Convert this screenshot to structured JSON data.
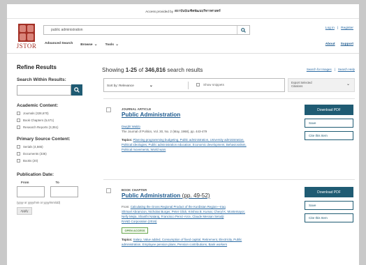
{
  "topbar": {
    "access_prefix": "Access provided by",
    "institution": "สถาบันบัณฑิตพัฒนบริหารศาสตร์"
  },
  "logo": {
    "text": "JSTOR"
  },
  "search": {
    "query": "public administration"
  },
  "nav": {
    "advanced": "Advanced Search",
    "browse": "Browse",
    "tools": "Tools"
  },
  "account": {
    "login": "Log in",
    "sep": "|",
    "register": "Register"
  },
  "links": {
    "about": "About",
    "support": "Support"
  },
  "sidebar": {
    "title": "Refine Results",
    "search_within": "Search Within Results:",
    "academic_heading": "Academic Content:",
    "academic": [
      "Journals (328,670)",
      "Book Chapters (5,671)",
      "Research Reports (3,351)"
    ],
    "primary_heading": "Primary Source Content:",
    "primary": [
      "Serials (4,566)",
      "Documents (336)",
      "Books (20)"
    ],
    "date_heading": "Publication Date:",
    "from_label": "From",
    "to_label": "To",
    "date_hint": "(yyyy or yyyy/mm or yyyy/mm/dd)",
    "apply": "Apply"
  },
  "results": {
    "showing": "Showing",
    "range": "1-25",
    "of": "of",
    "total": "346,816",
    "suffix": "search results",
    "search_images": "Search for Images",
    "sep": "|",
    "search_help": "Search Help",
    "sort_label": "Sort by: Relevance",
    "show_snippets": "Show snippets",
    "export_line1": "Export Selected",
    "export_line2": "Citations"
  },
  "items": [
    {
      "type": "JOURNAL ARTICLE",
      "title": "Public Administration",
      "author": "Dwight Waldo",
      "source": "The Journal of Politics, Vol. 30, No. 2 (May, 1968), pp. 443-479",
      "topics_label": "Topics:",
      "topics_line1": "Planning programming budgeting, Public administration, University administration,",
      "topics_line2": "Political ideologies, Public administration education, Economic development, Behavioralism,",
      "topics_line3": "Political movements, World wars"
    },
    {
      "type": "BOOK CHAPTER",
      "title": "Public Administration",
      "pages": "(pp. 49-52)",
      "from_label": "From:",
      "from_line1": "Calculating the Gross Regional Product of the Kurdistan Region—Iraq",
      "from_line2": "Shmuel Abramzon, Nicholas Burger, Peter Glick, Krishna B. Kumar, Cheryl K. Montemayor,",
      "from_line3": "Nelly Mejia, Shanthi Nataraj, Francisco Perez-Arce, Claude Messan Setodji",
      "from_line4": "RAND Corporation (2016)",
      "open_access": "OPEN ACCESS",
      "topics_label": "Topics:",
      "topics_line1": "Salary, Value added, Consumption of fixed capital, Retirement, Electricity, Public",
      "topics_line2": "administration, Employee pension plans, Pension contributions, Bank workers"
    }
  ],
  "actions": {
    "download": "Download PDF",
    "save": "Save",
    "cite": "Cite this Item"
  }
}
